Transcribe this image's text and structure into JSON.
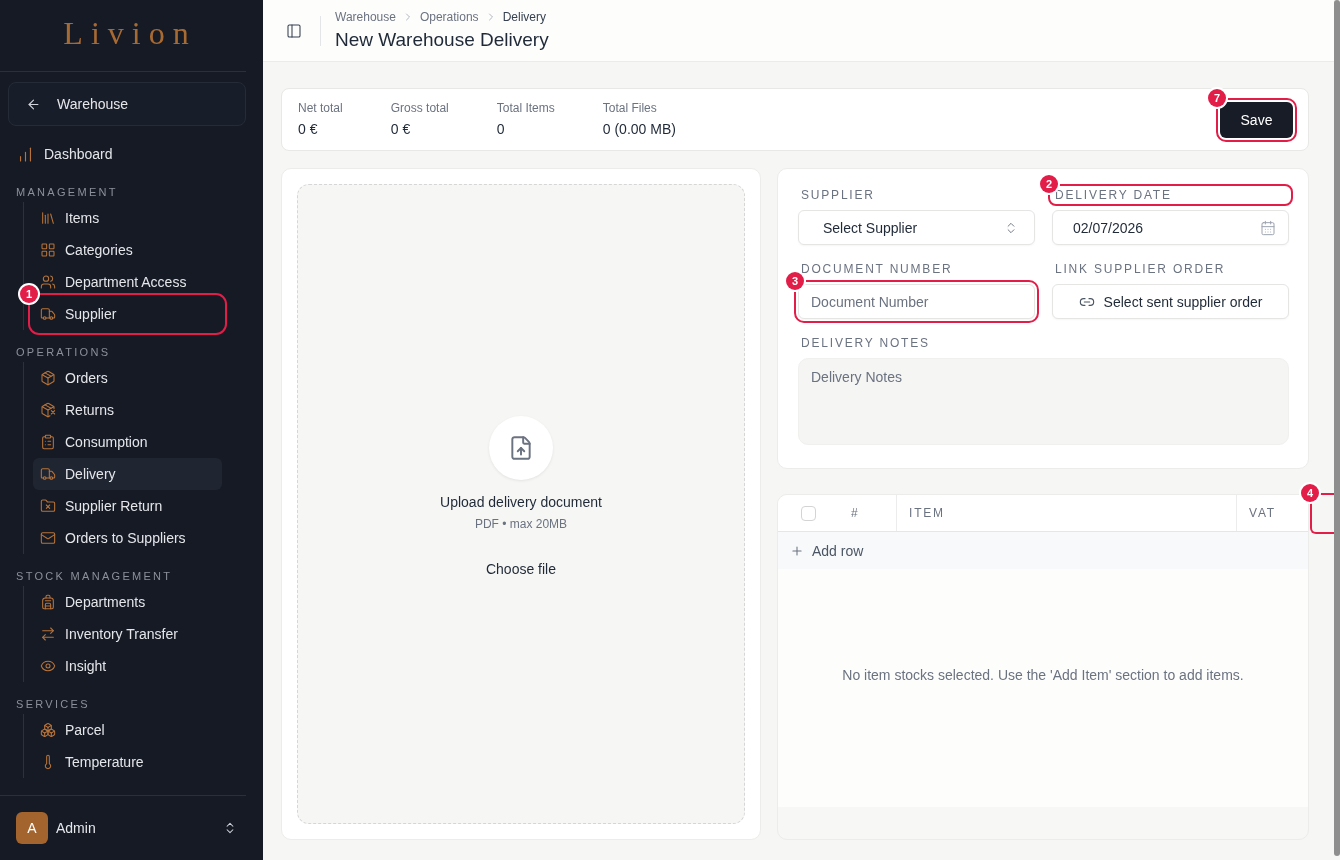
{
  "sidebar": {
    "logo": "Livion",
    "back_button": "Warehouse",
    "items": [
      {
        "label": "Dashboard",
        "selected": false
      }
    ],
    "sections": [
      {
        "title": "MANAGEMENT",
        "items": [
          {
            "label": "Items",
            "selected": false
          },
          {
            "label": "Categories",
            "selected": false
          },
          {
            "label": "Department Access",
            "selected": false
          },
          {
            "label": "Supplier",
            "selected": false,
            "annotation": {
              "number": "1"
            }
          }
        ]
      },
      {
        "title": "OPERATIONS",
        "items": [
          {
            "label": "Orders",
            "selected": false
          },
          {
            "label": "Returns",
            "selected": false
          },
          {
            "label": "Consumption",
            "selected": false
          },
          {
            "label": "Delivery",
            "selected": true
          },
          {
            "label": "Supplier Return",
            "selected": false
          },
          {
            "label": "Orders to Suppliers",
            "selected": false
          }
        ]
      },
      {
        "title": "STOCK MANAGEMENT",
        "items": [
          {
            "label": "Departments",
            "selected": false
          },
          {
            "label": "Inventory Transfer",
            "selected": false
          },
          {
            "label": "Insight",
            "selected": false
          }
        ]
      },
      {
        "title": "SERVICES",
        "items": [
          {
            "label": "Parcel",
            "selected": false
          },
          {
            "label": "Temperature",
            "selected": false
          }
        ]
      }
    ],
    "user": {
      "initial": "A",
      "name": "Admin"
    }
  },
  "header": {
    "breadcrumb": [
      {
        "label": "Warehouse",
        "current": false
      },
      {
        "label": "Operations",
        "current": false
      },
      {
        "label": "Delivery",
        "current": true
      }
    ],
    "title": "New Warehouse Delivery"
  },
  "summary": {
    "stats": [
      {
        "label": "Net total",
        "value": "0 €"
      },
      {
        "label": "Gross total",
        "value": "0 €"
      },
      {
        "label": "Total Items",
        "value": "0"
      },
      {
        "label": "Total Files",
        "value": "0 (0.00 MB)"
      }
    ],
    "save_button": {
      "label": "Save",
      "annotation": {
        "number": "7"
      }
    }
  },
  "upload": {
    "title": "Upload delivery document",
    "hint": "PDF • max 20MB",
    "button": "Choose file"
  },
  "form": {
    "fields": [
      {
        "kind": "select",
        "label": "SUPPLIER",
        "value": "Select Supplier"
      },
      {
        "kind": "date",
        "label": "DELIVERY DATE",
        "value": "02/07/2026",
        "label_annotation": {
          "number": "2"
        }
      },
      {
        "kind": "text",
        "label": "DOCUMENT NUMBER",
        "placeholder": "Document Number",
        "annotation": {
          "number": "3"
        }
      },
      {
        "kind": "link",
        "label": "LINK SUPPLIER ORDER",
        "value": "Select sent supplier order"
      },
      {
        "kind": "textarea",
        "label": "DELIVERY NOTES",
        "placeholder": "Delivery Notes"
      }
    ]
  },
  "table": {
    "select_all": {
      "checked": false
    },
    "columns": [
      "#",
      "ITEM",
      "VAT"
    ],
    "add_row": "Add row",
    "empty_message": "No item stocks selected. Use the 'Add Item' section to add items.",
    "annotation": {
      "number": "4"
    }
  }
}
